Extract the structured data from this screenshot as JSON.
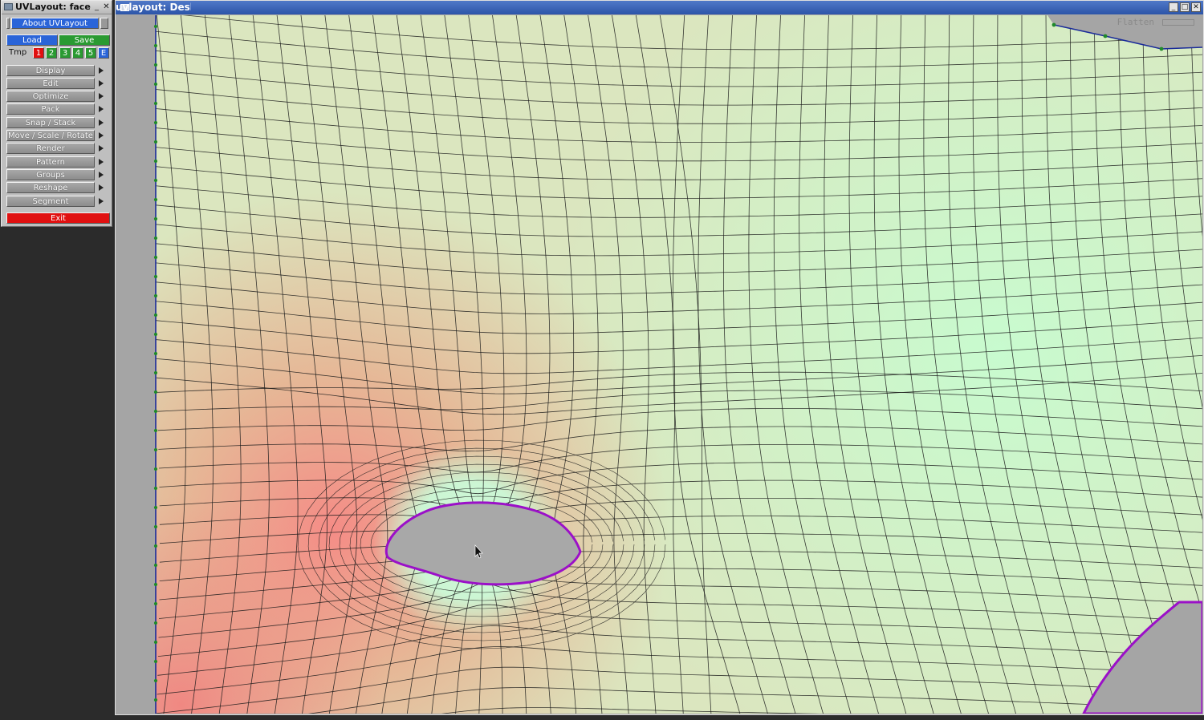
{
  "panel": {
    "title": "UVLayout: face",
    "about_label": "About UVLayout",
    "load_label": "Load",
    "save_label": "Save",
    "tmp_label": "Tmp",
    "tmp_slots": [
      "1",
      "2",
      "3",
      "4",
      "5",
      "E"
    ],
    "menu_items": [
      "Display",
      "Edit",
      "Optimize",
      "Pack",
      "Snap / Stack",
      "Move / Scale / Rotate",
      "Render",
      "Pattern",
      "Groups",
      "Reshape",
      "Segment"
    ],
    "exit_label": "Exit"
  },
  "viewport": {
    "title": "uvlayout: Desktop/face.obj",
    "mode_label": "Flatten"
  },
  "colors": {
    "background": "#a5a5a5",
    "mesh_stretch_high": "#f08a84",
    "mesh_stretch_neutral": "#d8e6bc",
    "mesh_compress": "#c8fbd0",
    "boundary_edge": "#9b10c8",
    "seam_edge": "#1a2b9a",
    "seam_vertex": "#1f8a2a",
    "grid_line": "#1a1a1a"
  },
  "icons": {
    "menu": "window-menu-icon",
    "minimize": "minimize-icon",
    "maximize": "maximize-icon",
    "close": "close-icon",
    "submenu": "triangle-right-icon",
    "cursor": "mouse-pointer-icon"
  }
}
